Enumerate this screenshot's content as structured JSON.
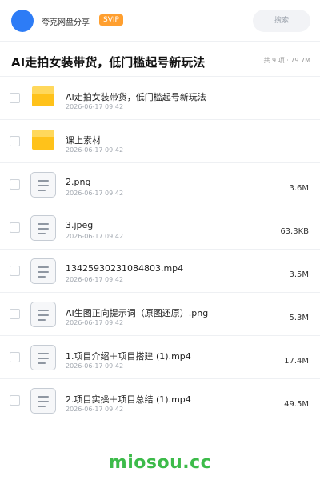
{
  "header": {
    "app_name": "夸克网盘分享",
    "badge": "SVIP",
    "search_label": "搜索"
  },
  "title_bar": {
    "title": "AI走拍女装带货，低门槛起号新玩法",
    "meta": "共 9 项 · 79.7M"
  },
  "files": [
    {
      "name": "AI走拍女装带货，低门槛起号新玩法",
      "date": "2026-06-17 09:42",
      "size": "",
      "kind": "folder-icon"
    },
    {
      "name": "课上素材",
      "date": "2026-06-17 09:42",
      "size": "",
      "kind": "folder-icon"
    },
    {
      "name": "2.png",
      "date": "2026-06-17 09:42",
      "size": "3.6M",
      "kind": "file-icon"
    },
    {
      "name": "3.jpeg",
      "date": "2026-06-17 09:42",
      "size": "63.3KB",
      "kind": "file-icon"
    },
    {
      "name": "13425930231084803.mp4",
      "date": "2026-06-17 09:42",
      "size": "3.5M",
      "kind": "file-icon"
    },
    {
      "name": "AI生图正向提示词（原图还原）.png",
      "date": "2026-06-17 09:42",
      "size": "5.3M",
      "kind": "file-icon"
    },
    {
      "name": "1.项目介绍＋项目搭建 (1).mp4",
      "date": "2026-06-17 09:42",
      "size": "17.4M",
      "kind": "file-icon"
    },
    {
      "name": "2.项目实操＋项目总结 (1).mp4",
      "date": "2026-06-17 09:42",
      "size": "49.5M",
      "kind": "file-icon"
    }
  ],
  "watermark": "miosou.cc",
  "colors": {
    "avatar": "#2d7cf6",
    "badge": "#ff9f2f",
    "folder": "#ffc21a",
    "watermark": "#3dbb4a"
  }
}
